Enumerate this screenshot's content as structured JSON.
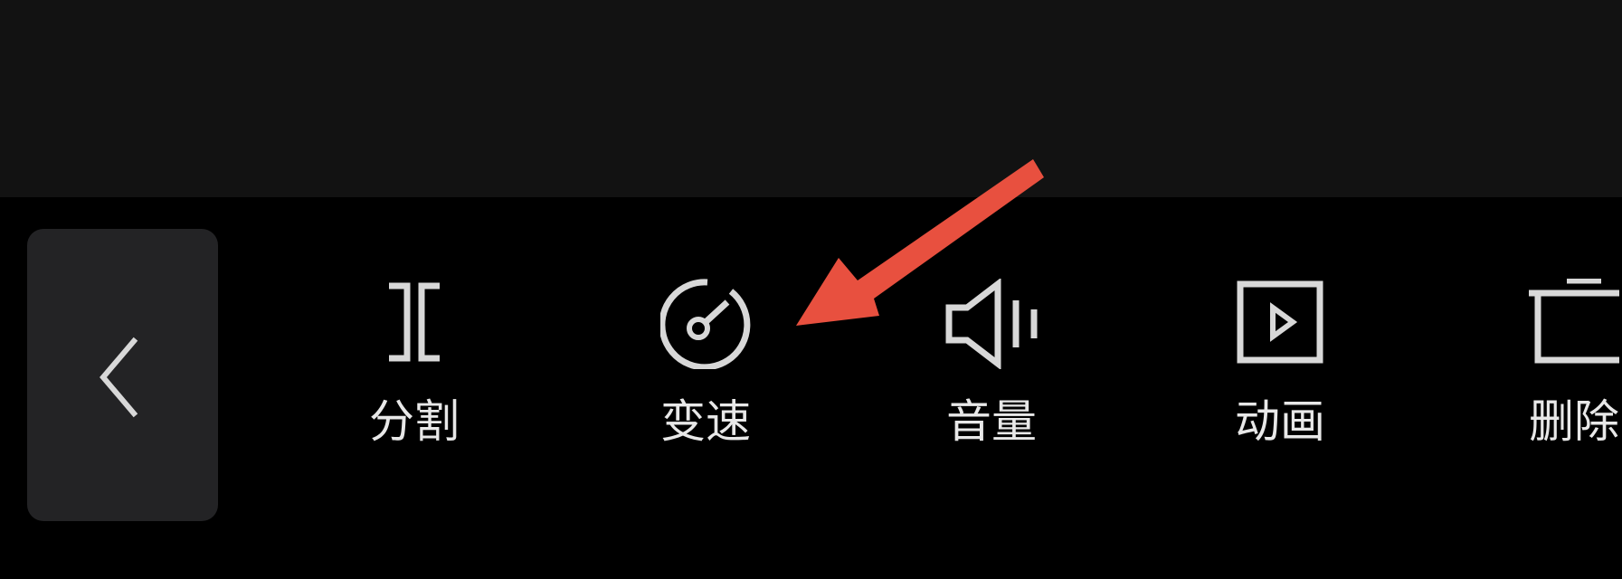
{
  "toolbar": {
    "back_icon": "chevron-left-icon",
    "items": [
      {
        "label": "分割",
        "icon": "split-icon"
      },
      {
        "label": "变速",
        "icon": "speed-gauge-icon"
      },
      {
        "label": "音量",
        "icon": "volume-icon"
      },
      {
        "label": "动画",
        "icon": "play-box-icon"
      },
      {
        "label": "删除",
        "icon": "trash-icon"
      }
    ]
  },
  "annotation": {
    "icon": "red-arrow-icon",
    "color": "#e8503f"
  },
  "colors": {
    "top_panel": "#121212",
    "toolbar_bg": "#000000",
    "back_button_bg": "#232325",
    "icon_stroke": "#d8d8d8",
    "label_text": "#e8e8e8"
  }
}
